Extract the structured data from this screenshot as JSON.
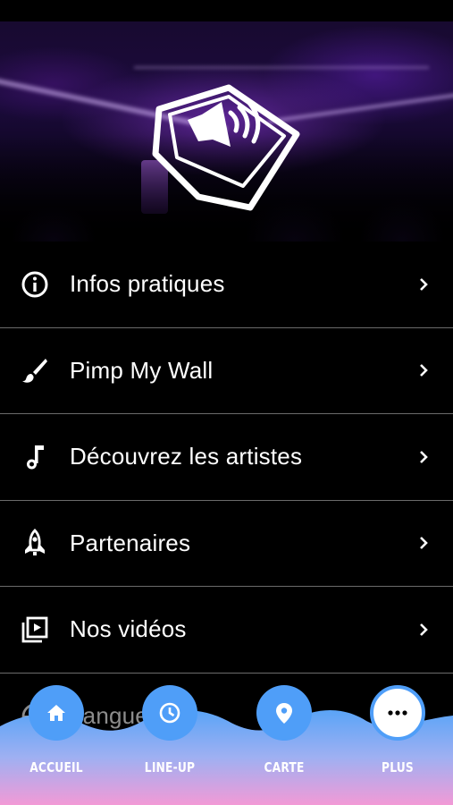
{
  "menu": {
    "items": [
      {
        "label": "Infos pratiques",
        "icon": "info-circle-icon"
      },
      {
        "label": "Pimp My Wall",
        "icon": "paintbrush-icon"
      },
      {
        "label": "Découvrez les artistes",
        "icon": "music-note-icon"
      },
      {
        "label": "Partenaires",
        "icon": "rocket-icon"
      },
      {
        "label": "Nos vidéos",
        "icon": "video-library-icon"
      },
      {
        "label": "Langue",
        "icon": "globe-icon"
      }
    ]
  },
  "tabbar": {
    "tabs": [
      {
        "label": "ACCUEIL",
        "icon": "home-icon"
      },
      {
        "label": "LINE-UP",
        "icon": "clock-icon"
      },
      {
        "label": "CARTE",
        "icon": "map-pin-icon"
      },
      {
        "label": "PLUS",
        "icon": "more-dots-icon",
        "active": true
      }
    ]
  },
  "colors": {
    "background": "#000000",
    "tab_circle": "#4f9ef8",
    "tab_circle_active": "#ffffff",
    "wave_top": "#62a8f6",
    "wave_bottom": "#f09ad8",
    "divider": "#6b6b6b"
  }
}
